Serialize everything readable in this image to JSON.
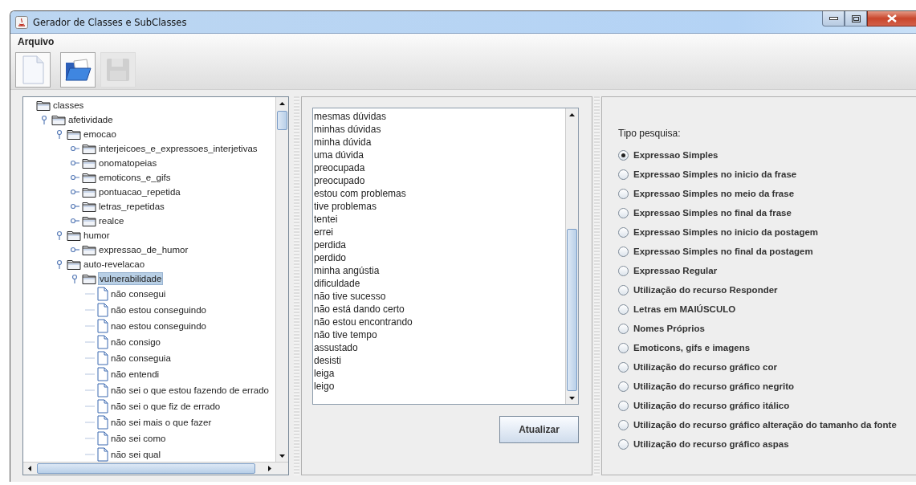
{
  "window": {
    "title": "Gerador de Classes e SubClasses"
  },
  "menu": [
    {
      "label": "Arquivo"
    }
  ],
  "toolbar": [
    {
      "kind": "new",
      "disabled": false
    },
    {
      "kind": "open",
      "disabled": false
    },
    {
      "kind": "save",
      "disabled": true
    }
  ],
  "tree": {
    "label": "classes",
    "kind": "folder",
    "selected": false,
    "children": [
      {
        "label": "afetividade",
        "kind": "folder",
        "expanded": true,
        "selected": false,
        "children": [
          {
            "label": "emocao",
            "kind": "folder",
            "expanded": true,
            "selected": false,
            "children": [
              {
                "label": "interjeicoes_e_expressoes_interjetivas",
                "kind": "folder",
                "expanded": false,
                "selected": false
              },
              {
                "label": "onomatopeias",
                "kind": "folder",
                "expanded": false,
                "selected": false
              },
              {
                "label": "emoticons_e_gifs",
                "kind": "folder",
                "expanded": false,
                "selected": false
              },
              {
                "label": "pontuacao_repetida",
                "kind": "folder",
                "expanded": false,
                "selected": false
              },
              {
                "label": "letras_repetidas",
                "kind": "folder",
                "expanded": false,
                "selected": false
              },
              {
                "label": "realce",
                "kind": "folder",
                "expanded": false,
                "selected": false
              }
            ]
          },
          {
            "label": "humor",
            "kind": "folder",
            "expanded": true,
            "selected": false,
            "children": [
              {
                "label": "expressao_de_humor",
                "kind": "folder",
                "expanded": false,
                "selected": false
              }
            ]
          },
          {
            "label": "auto-revelacao",
            "kind": "folder",
            "expanded": true,
            "selected": false,
            "children": [
              {
                "label": "vulnerabilidade",
                "kind": "folder",
                "expanded": true,
                "selected": true,
                "children": [
                  {
                    "label": "não consegui",
                    "kind": "leaf",
                    "selected": false
                  },
                  {
                    "label": "não estou conseguindo",
                    "kind": "leaf",
                    "selected": false
                  },
                  {
                    "label": "nao estou conseguindo",
                    "kind": "leaf",
                    "selected": false
                  },
                  {
                    "label": "não consigo",
                    "kind": "leaf",
                    "selected": false
                  },
                  {
                    "label": "não conseguia",
                    "kind": "leaf",
                    "selected": false
                  },
                  {
                    "label": "não entendi",
                    "kind": "leaf",
                    "selected": false
                  },
                  {
                    "label": "não sei o que estou fazendo de errado",
                    "kind": "leaf",
                    "selected": false
                  },
                  {
                    "label": "não sei o que fiz de errado",
                    "kind": "leaf",
                    "selected": false
                  },
                  {
                    "label": "não sei mais o que fazer",
                    "kind": "leaf",
                    "selected": false
                  },
                  {
                    "label": "não sei como",
                    "kind": "leaf",
                    "selected": false
                  },
                  {
                    "label": "não sei qual",
                    "kind": "leaf",
                    "selected": false
                  }
                ]
              }
            ]
          }
        ]
      }
    ]
  },
  "list": {
    "items": [
      "mesmas dúvidas",
      "minhas dúvidas",
      "minha dúvida",
      "uma dúvida",
      "preocupada",
      "preocupado",
      "estou com problemas",
      "tive problemas",
      "tentei",
      "errei",
      "perdida",
      "perdido",
      "minha angústia",
      "dificuldade",
      "não tive sucesso",
      "não está dando certo",
      "não estou encontrando",
      "não tive tempo",
      "assustado",
      "desisti",
      "leiga",
      "leigo"
    ]
  },
  "update_button": "Atualizar",
  "search_type": {
    "label": "Tipo pesquisa:",
    "options": [
      {
        "label": "Expressao Simples",
        "selected": true
      },
      {
        "label": "Expressao Simples no inicio da frase",
        "selected": false
      },
      {
        "label": "Expressao Simples no meio da frase",
        "selected": false
      },
      {
        "label": "Expressao Simples no final da frase",
        "selected": false
      },
      {
        "label": "Expressao Simples no inicio da postagem",
        "selected": false
      },
      {
        "label": "Expressao Simples no final da postagem",
        "selected": false
      },
      {
        "label": "Expressao Regular",
        "selected": false
      },
      {
        "label": "Utilização do recurso Responder",
        "selected": false
      },
      {
        "label": "Letras em MAIÚSCULO",
        "selected": false
      },
      {
        "label": "Nomes Próprios",
        "selected": false
      },
      {
        "label": "Emoticons, gifs e imagens",
        "selected": false
      },
      {
        "label": "Utilização do recurso gráfico cor",
        "selected": false
      },
      {
        "label": "Utilização do recurso gráfico negrito",
        "selected": false
      },
      {
        "label": "Utilização do recurso gráfico itálico",
        "selected": false
      },
      {
        "label": "Utilização do recurso gráfico alteração do tamanho da fonte",
        "selected": false
      },
      {
        "label": "Utilização do recurso gráfico aspas",
        "selected": false
      }
    ]
  }
}
